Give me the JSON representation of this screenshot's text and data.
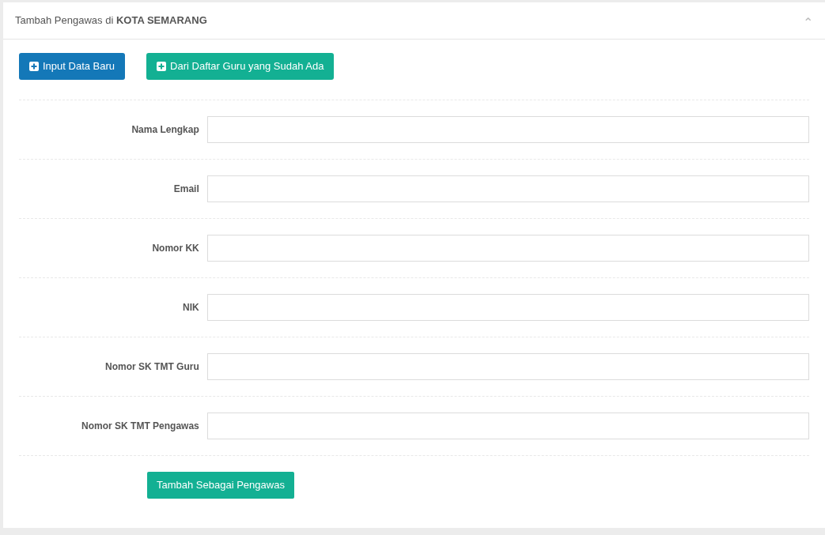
{
  "panel": {
    "title": "Tambah Pengawas di **KOTA SEMARANG**",
    "collapse_symbol": "⌃"
  },
  "actions": [
    {
      "label": "Input Data Baru",
      "kind": "primary"
    },
    {
      "label": "Dari Daftar Guru yang Sudah Ada",
      "kind": "success"
    }
  ],
  "fields": [
    {
      "label": "Nama Lengkap"
    },
    {
      "label": "Email"
    },
    {
      "label": "Nomor KK"
    },
    {
      "label": "NIK"
    },
    {
      "label": "Nomor SK TMT Guru"
    },
    {
      "label": "Nomor SK TMT Pengawas"
    }
  ],
  "submit": {
    "label": "Tambah Sebagai Pengawas"
  }
}
